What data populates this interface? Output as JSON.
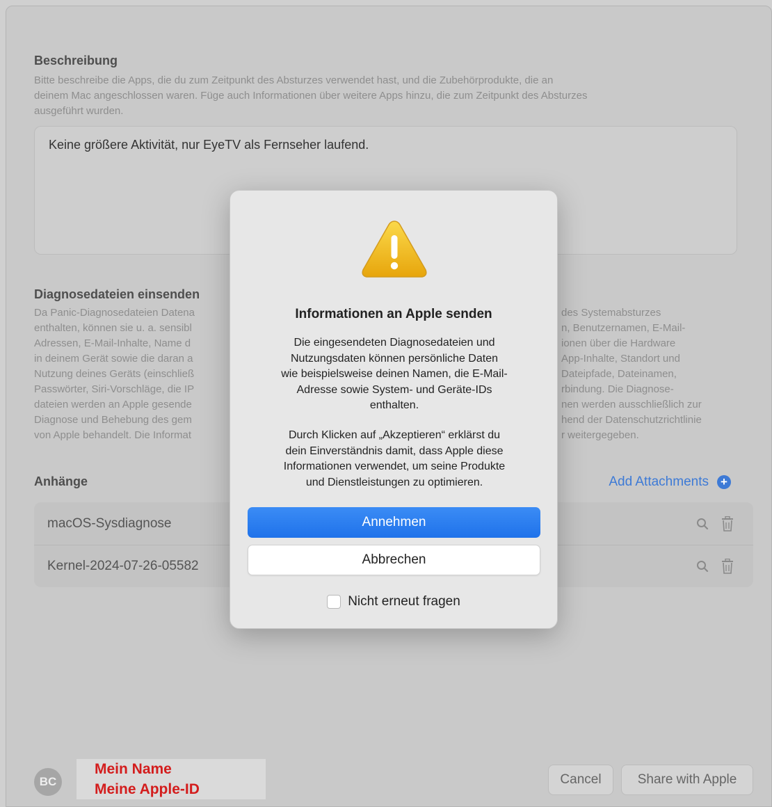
{
  "description": {
    "title": "Beschreibung",
    "help_lines": [
      "Bitte beschreibe die Apps, die du zum Zeitpunkt des Absturzes verwendet hast, und die Zubehörprodukte, die an",
      "deinem Mac angeschlossen waren. Füge auch Informationen über weitere Apps hinzu, die zum Zeitpunkt des Absturzes",
      "ausgeführt wurden."
    ],
    "value": "Keine größere Aktivität, nur EyeTV als Fernseher laufend."
  },
  "diagnostics": {
    "title": "Diagnosedateien einsenden",
    "left_lines": [
      "Da Panic-Diagnosedateien Datena",
      "enthalten, können sie u. a. sensibl",
      "Adressen, E-Mail-Inhalte, Name d",
      "in deinem Gerät sowie die daran a",
      "Nutzung deines Geräts (einschließ",
      "Passwörter, Siri-Vorschläge, die IP",
      "dateien werden an Apple gesende",
      "Diagnose und Behebung des gem",
      "von Apple behandelt. Die Informat"
    ],
    "right_lines": [
      "des Systemabsturzes",
      "n, Benutzernamen, E-Mail-",
      "ionen über die Hardware",
      "App-Inhalte, Standort und",
      "Dateipfade, Dateinamen,",
      "rbindung. Die Diagnose-",
      "nen werden ausschließlich zur",
      "hend der Datenschutzrichtlinie",
      "r weitergegeben."
    ]
  },
  "attachments": {
    "title": "Anhänge",
    "add_label": "Add Attachments",
    "items": [
      {
        "name": "macOS-Sysdiagnose"
      },
      {
        "name": "Kernel-2024-07-26-05582"
      }
    ]
  },
  "footer": {
    "avatar_initials": "BC",
    "name": "Mein Name",
    "apple_id": "Meine Apple-ID",
    "cancel_label": "Cancel",
    "share_label": "Share with Apple"
  },
  "dialog": {
    "title": "Informationen an Apple senden",
    "body_1": [
      "Die eingesendeten Diagnosedateien und",
      "Nutzungsdaten können persönliche Daten",
      "wie beispielsweise deinen Namen, die E-Mail-",
      "Adresse sowie System- und Geräte-IDs",
      "enthalten."
    ],
    "body_2": [
      "Durch Klicken auf „Akzeptieren“ erklärst du",
      "dein Einverständnis damit, dass Apple diese",
      "Informationen verwendet, um seine Produkte",
      "und Dienstleistungen zu optimieren."
    ],
    "accept_label": "Annehmen",
    "cancel_label": "Abbrechen",
    "checkbox_label": "Nicht erneut fragen",
    "checkbox_checked": false
  },
  "colors": {
    "accent": "#1f72ea",
    "link": "#3d7ad6",
    "redact_text": "#d31d1d"
  }
}
